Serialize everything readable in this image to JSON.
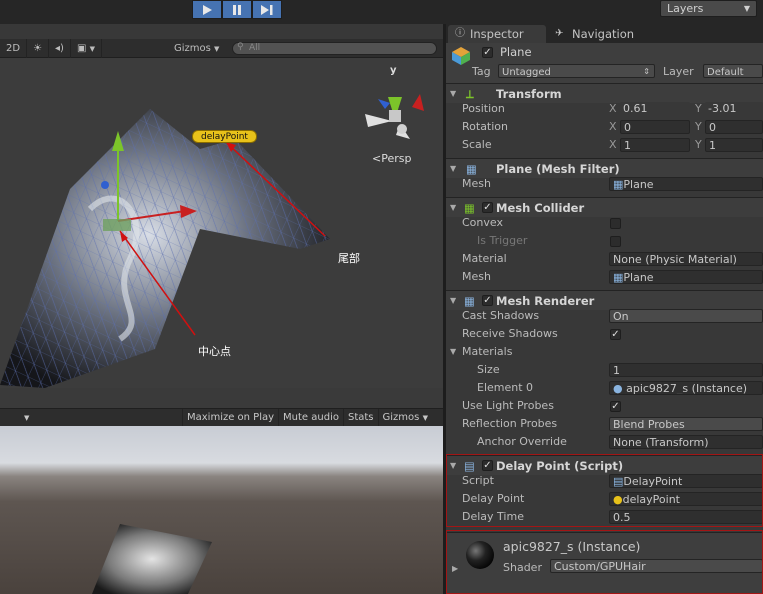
{
  "toolbar": {
    "layers_label": "Layers"
  },
  "scene_toolbar": {
    "mode_2d": "2D",
    "gizmos": "Gizmos",
    "search_placeholder": "All"
  },
  "scene": {
    "persp_label": "Persp",
    "axis_y": "y",
    "delay_point_tag": "delayPoint",
    "annot_tail": "尾部",
    "annot_center": "中心点"
  },
  "game_toolbar": {
    "maximize": "Maximize on Play",
    "mute": "Mute audio",
    "stats": "Stats",
    "gizmos": "Gizmos"
  },
  "inspector": {
    "tabs": [
      "Inspector",
      "Navigation"
    ],
    "object": {
      "name": "Plane",
      "tag_label": "Tag",
      "tag_value": "Untagged",
      "layer_label": "Layer",
      "layer_value": "Default"
    },
    "transform": {
      "title": "Transform",
      "rows": [
        {
          "label": "Position",
          "x": "0.61",
          "y": "-3.01"
        },
        {
          "label": "Rotation",
          "x": "0",
          "y": "0"
        },
        {
          "label": "Scale",
          "x": "1",
          "y": "1"
        }
      ]
    },
    "mesh_filter": {
      "title": "Plane (Mesh Filter)",
      "mesh_label": "Mesh",
      "mesh_value": "Plane"
    },
    "mesh_collider": {
      "title": "Mesh Collider",
      "convex": "Convex",
      "is_trigger": "Is Trigger",
      "material_label": "Material",
      "material_value": "None (Physic Material)",
      "mesh_label": "Mesh",
      "mesh_value": "Plane"
    },
    "mesh_renderer": {
      "title": "Mesh Renderer",
      "cast_shadows": "Cast Shadows",
      "cast_value": "On",
      "receive_shadows": "Receive Shadows",
      "materials": "Materials",
      "size_label": "Size",
      "size_value": "1",
      "element0_label": "Element 0",
      "element0_value": "apic9827_s (Instance)",
      "light_probes": "Use Light Probes",
      "reflection_probes": "Reflection Probes",
      "reflection_value": "Blend Probes",
      "anchor_label": "Anchor Override",
      "anchor_value": "None (Transform)"
    },
    "delay_script": {
      "title": "Delay Point (Script)",
      "script_label": "Script",
      "script_value": "DelayPoint",
      "delay_point_label": "Delay Point",
      "delay_point_value": "delayPoint",
      "delay_time_label": "Delay Time",
      "delay_time_value": "0.5"
    },
    "material": {
      "name": "apic9827_s (Instance)",
      "shader_label": "Shader",
      "shader_value": "Custom/GPUHair"
    }
  },
  "colors": {
    "accent": "#4673b2",
    "highlight_box": "#a31515",
    "annotation_arrow": "#d01010",
    "tag_yellow": "#e8c21a"
  }
}
